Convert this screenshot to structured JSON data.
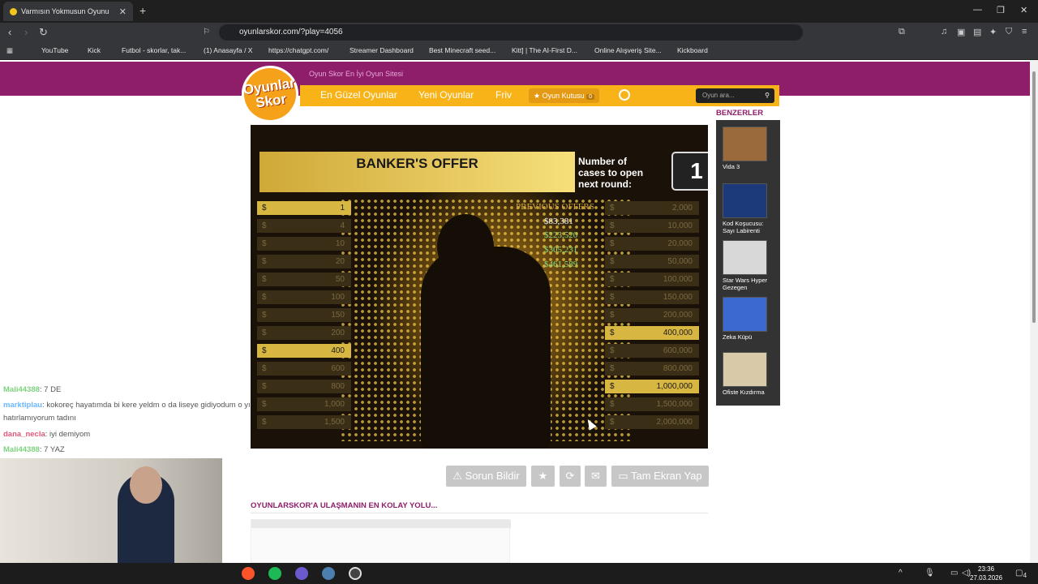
{
  "browser": {
    "tab_title": "Varmısın Yokmusun Oyunu O",
    "new_tab": "+",
    "url": "oyunlarskor.com/?play=4056",
    "bookmarks": [
      {
        "label": "YouTube",
        "color": "#ff0000"
      },
      {
        "label": "Kick",
        "color": "#53fc18"
      },
      {
        "label": "Futbol - skorlar, tak...",
        "color": "#e94560"
      },
      {
        "label": "(1) Anasayfa / X",
        "color": "#ffffff"
      },
      {
        "label": "https://chatgpt.com/",
        "color": "#cccccc"
      },
      {
        "label": "Streamer Dashboard",
        "color": "#e83e5a"
      },
      {
        "label": "Best Minecraft seed...",
        "color": "#5a4fcf"
      },
      {
        "label": "Kitt] | The AI-First D...",
        "color": "#ffffff"
      },
      {
        "label": "Online Alışveriş Site...",
        "color": "#f27a1a"
      },
      {
        "label": "Kickboard",
        "color": "#cccccc"
      }
    ]
  },
  "site": {
    "logo_line1": "Oyunlar",
    "logo_line2": "Skor",
    "tagline": "Oyun Skor En İyi Oyun Sitesi",
    "nav": [
      "En Güzel Oyunlar",
      "Yeni Oyunlar",
      "Friv"
    ],
    "game_box_label": "Oyun Kutusu",
    "game_box_count": "0",
    "search_placeholder": "Oyun ara..."
  },
  "game": {
    "offer_title": "BANKER'S OFFER",
    "cases_label": "Number of cases to open next round:",
    "cases_count": "1",
    "previous_title": "PREVIOUS OFFERS",
    "previous_offers": [
      "$83,381",
      "$223,520",
      "$305,231",
      "$461,589"
    ],
    "left_values": [
      {
        "d": "$",
        "v": "1",
        "on": true
      },
      {
        "d": "$",
        "v": "4",
        "on": false
      },
      {
        "d": "$",
        "v": "10",
        "on": false
      },
      {
        "d": "$",
        "v": "20",
        "on": false
      },
      {
        "d": "$",
        "v": "50",
        "on": false
      },
      {
        "d": "$",
        "v": "100",
        "on": false
      },
      {
        "d": "$",
        "v": "150",
        "on": false
      },
      {
        "d": "$",
        "v": "200",
        "on": false
      },
      {
        "d": "$",
        "v": "400",
        "on": true
      },
      {
        "d": "$",
        "v": "600",
        "on": false
      },
      {
        "d": "$",
        "v": "800",
        "on": false
      },
      {
        "d": "$",
        "v": "1,000",
        "on": false
      },
      {
        "d": "$",
        "v": "1,500",
        "on": false
      }
    ],
    "right_values": [
      {
        "d": "$",
        "v": "2,000",
        "on": false
      },
      {
        "d": "$",
        "v": "10,000",
        "on": false
      },
      {
        "d": "$",
        "v": "20,000",
        "on": false
      },
      {
        "d": "$",
        "v": "50,000",
        "on": false
      },
      {
        "d": "$",
        "v": "100,000",
        "on": false
      },
      {
        "d": "$",
        "v": "150,000",
        "on": false
      },
      {
        "d": "$",
        "v": "200,000",
        "on": false
      },
      {
        "d": "$",
        "v": "400,000",
        "on": true
      },
      {
        "d": "$",
        "v": "600,000",
        "on": false
      },
      {
        "d": "$",
        "v": "800,000",
        "on": false
      },
      {
        "d": "$",
        "v": "1,000,000",
        "on": true
      },
      {
        "d": "$",
        "v": "1,500,000",
        "on": false
      },
      {
        "d": "$",
        "v": "2,000,000",
        "on": false
      }
    ]
  },
  "actions": {
    "report": "Sorun Bildir",
    "fullscreen": "Tam Ekran Yap"
  },
  "below": {
    "heading": "OYUNLARSKOR'A ULAŞMANIN EN KOLAY YOLU..."
  },
  "sidebar": {
    "title": "BENZERLER",
    "items": [
      {
        "label": "Vida 3",
        "color": "#9b6a3c"
      },
      {
        "label": "Kod Koşucusu: Sayı Labirenti",
        "color": "#1c3a7a"
      },
      {
        "label": "Star Wars Hyper Gezegen",
        "color": "#d8d8d8"
      },
      {
        "label": "Zeka Küpü",
        "color": "#3a6ad0"
      },
      {
        "label": "Ofiste Kızdırma",
        "color": "#d8c9a8"
      }
    ]
  },
  "chat": [
    {
      "user": "Mali44388",
      "msg": ": 7 DE",
      "color": "#7fd17f"
    },
    {
      "user": "marktiplau",
      "msg": ": kokoreç hayatımda bi kere yeldm o da liseye gidiyodum o yı",
      "color": "#6ab7ff"
    },
    {
      "user": "",
      "msg": "hatırlamıyorum tadını",
      "color": "#ffffff"
    },
    {
      "user": "dana_necla",
      "msg": ": iyi demiyom",
      "color": "#e05a7a"
    },
    {
      "user": "Mali44388",
      "msg": ": 7 YAZ",
      "color": "#7fd17f"
    }
  ],
  "taskbar": {
    "time": "23:36",
    "date": "27.03.2026",
    "notif": "4"
  }
}
